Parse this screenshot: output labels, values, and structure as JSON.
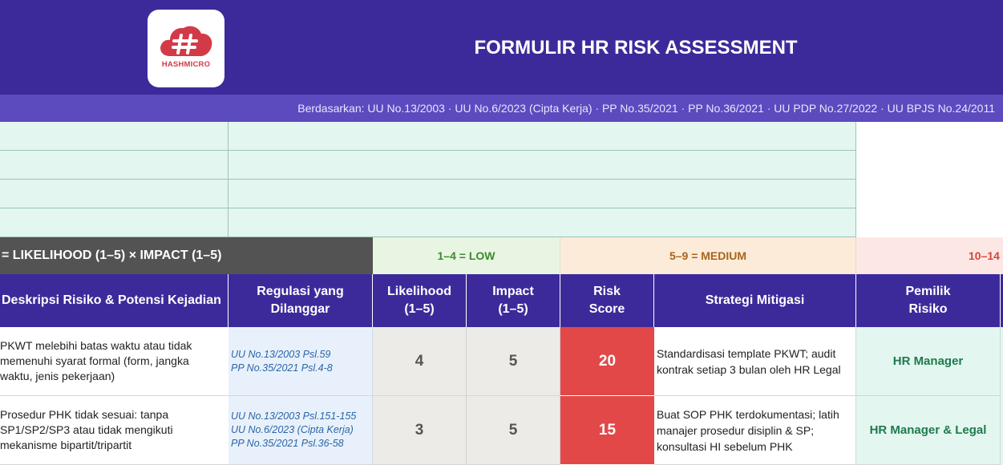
{
  "header": {
    "logo_text": "HASHMICRO",
    "title": "FORMULIR HR RISK ASSESSMENT",
    "subtitle": "Berdasarkan: UU No.13/2003 · UU No.6/2023 (Cipta Kerja) · PP No.35/2021 · PP No.36/2021 · UU PDP No.27/2022 · UU BPJS No.24/2011"
  },
  "legend": {
    "formula": "= LIKELIHOOD (1–5) × IMPACT (1–5)",
    "low": "1–4 = LOW",
    "medium": "5–9 = MEDIUM",
    "high": "10–14"
  },
  "columns": {
    "description": "Deskripsi Risiko & Potensi Kejadian",
    "regulation": "Regulasi yang\nDilanggar",
    "likelihood": "Likelihood\n(1–5)",
    "impact": "Impact\n(1–5)",
    "risk_score": "Risk\nScore",
    "mitigation": "Strategi Mitigasi",
    "owner": "Pemilik\nRisiko"
  },
  "rows": [
    {
      "description": "PKWT melebihi batas waktu atau tidak\nmemenuhi syarat formal (form, jangka\nwaktu, jenis pekerjaan)",
      "regulation": "UU No.13/2003 Psl.59\nPP No.35/2021 Psl.4-8",
      "likelihood": "4",
      "impact": "5",
      "risk_score": "20",
      "mitigation": "Standardisasi template PKWT; audit\nkontrak setiap 3 bulan oleh HR Legal",
      "owner": "HR Manager"
    },
    {
      "description": "Prosedur PHK tidak sesuai: tanpa\nSP1/SP2/SP3 atau tidak mengikuti\nmekanisme bipartit/tripartit",
      "regulation": "UU No.13/2003 Psl.151-155\nUU No.6/2023 (Cipta Kerja)\nPP No.35/2021 Psl.36-58",
      "likelihood": "3",
      "impact": "5",
      "risk_score": "15",
      "mitigation": "Buat SOP PHK terdokumentasi; latih\nmanajer prosedur disiplin & SP;\nkonsultasi HI sebelum PHK",
      "owner": "HR Manager & Legal"
    }
  ],
  "colors": {
    "header_bg": "#3d2a9a",
    "subbar_bg": "#5c4abf",
    "low_bg": "#e9f5e3",
    "medium_bg": "#fcebd9",
    "high_bg": "#fde7e4",
    "score_high": "#e34848",
    "brand": "#d33a48"
  }
}
